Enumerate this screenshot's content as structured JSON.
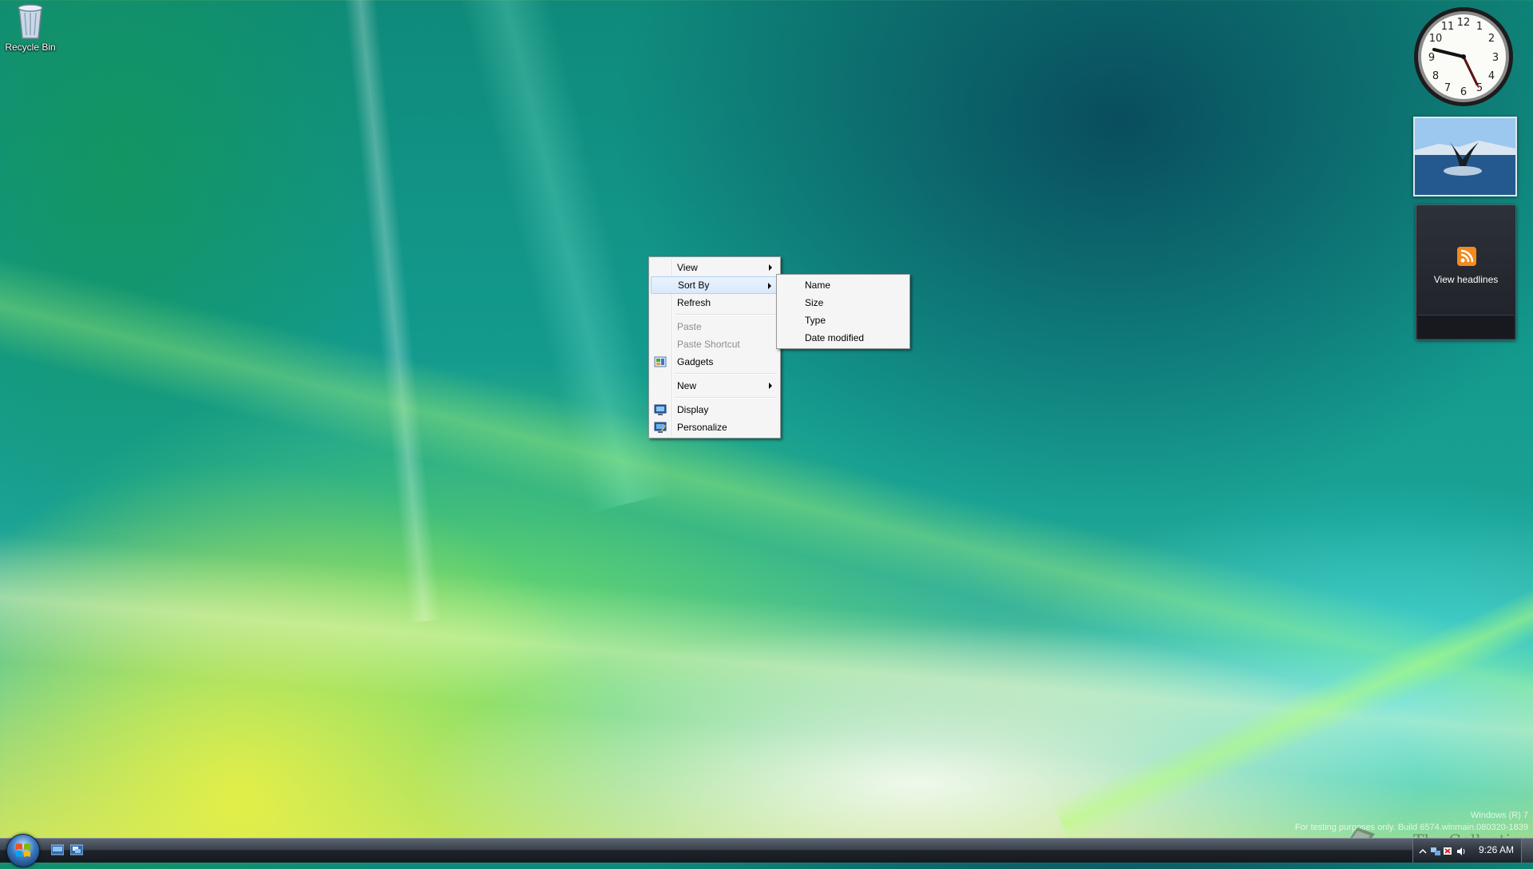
{
  "desktop": {
    "recycle_bin_label": "Recycle Bin"
  },
  "context_menu": {
    "items": [
      {
        "label": "View"
      },
      {
        "label": "Sort By"
      },
      {
        "label": "Refresh"
      },
      {
        "label": "Paste"
      },
      {
        "label": "Paste Shortcut"
      },
      {
        "label": "Gadgets"
      },
      {
        "label": "New"
      },
      {
        "label": "Display"
      },
      {
        "label": "Personalize"
      }
    ]
  },
  "sort_by_submenu": {
    "items": [
      {
        "label": "Name"
      },
      {
        "label": "Size"
      },
      {
        "label": "Type"
      },
      {
        "label": "Date modified"
      }
    ]
  },
  "gadgets": {
    "feed_label": "View headlines"
  },
  "watermark": {
    "line1": "Windows (R) 7",
    "line2": "For testing purposes only. Build 6574.winmain.080320-1839"
  },
  "branding": {
    "text": "The Collection Book"
  },
  "taskbar": {
    "time": "9:26 AM"
  },
  "colors": {
    "menu_background": "#f5f5f5",
    "menu_highlight": "#d9e9fb",
    "disabled_text": "#8d8d8d"
  }
}
